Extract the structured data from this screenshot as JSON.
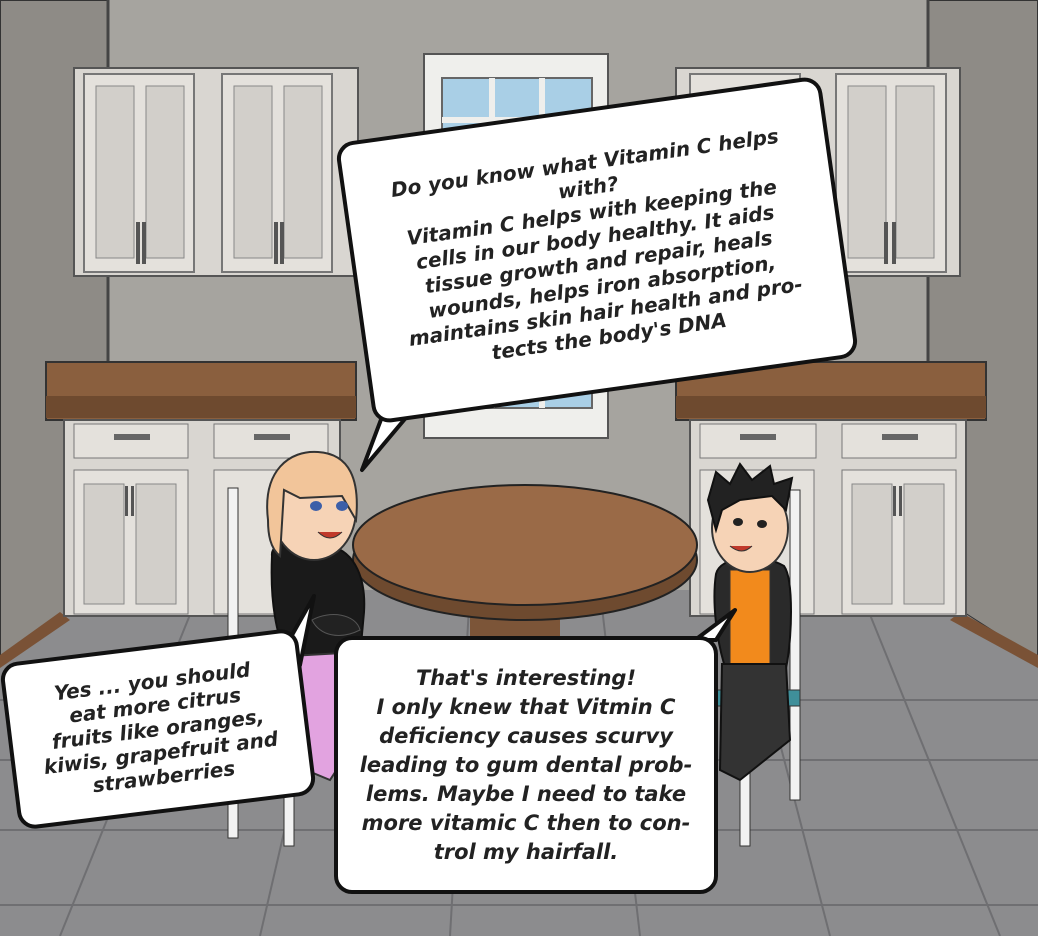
{
  "comic": {
    "bubble_1_lines": [
      "Do you know what Vitamin C helps",
      "with?",
      "Vitamin C helps with keeping the",
      "cells in our body healthy. It aids",
      "tissue growth and repair, heals",
      "wounds, helps iron absorption,",
      "maintains skin hair health and pro-",
      "tects the body's DNA"
    ],
    "bubble_2_lines": [
      "Yes ... you should",
      "eat more citrus",
      "fruits like oranges,",
      "kiwis, grapefruit and",
      "strawberries"
    ],
    "bubble_3_lines": [
      "That's interesting!",
      "I only knew that Vitmin C",
      "deficiency causes scurvy",
      "leading to gum dental prob-",
      "lems. Maybe I need to take",
      "more vitamic C then to con-",
      "trol my hairfall."
    ]
  },
  "colors": {
    "wall": "#a6a49f",
    "wall_side": "#8e8b86",
    "floor": "#8c8c8e",
    "cabinet": "#d9d6d1",
    "countertop": "#8a5f3e",
    "table": "#9a6a47",
    "window_glass": "#a9cfe6",
    "girl_hair": "#f2c59a",
    "girl_top": "#1a1a1a",
    "girl_pants": "#e2a3e0",
    "boy_hair": "#222222",
    "boy_shirt": "#f28a1c",
    "boy_jacket": "#2a2a2a"
  }
}
